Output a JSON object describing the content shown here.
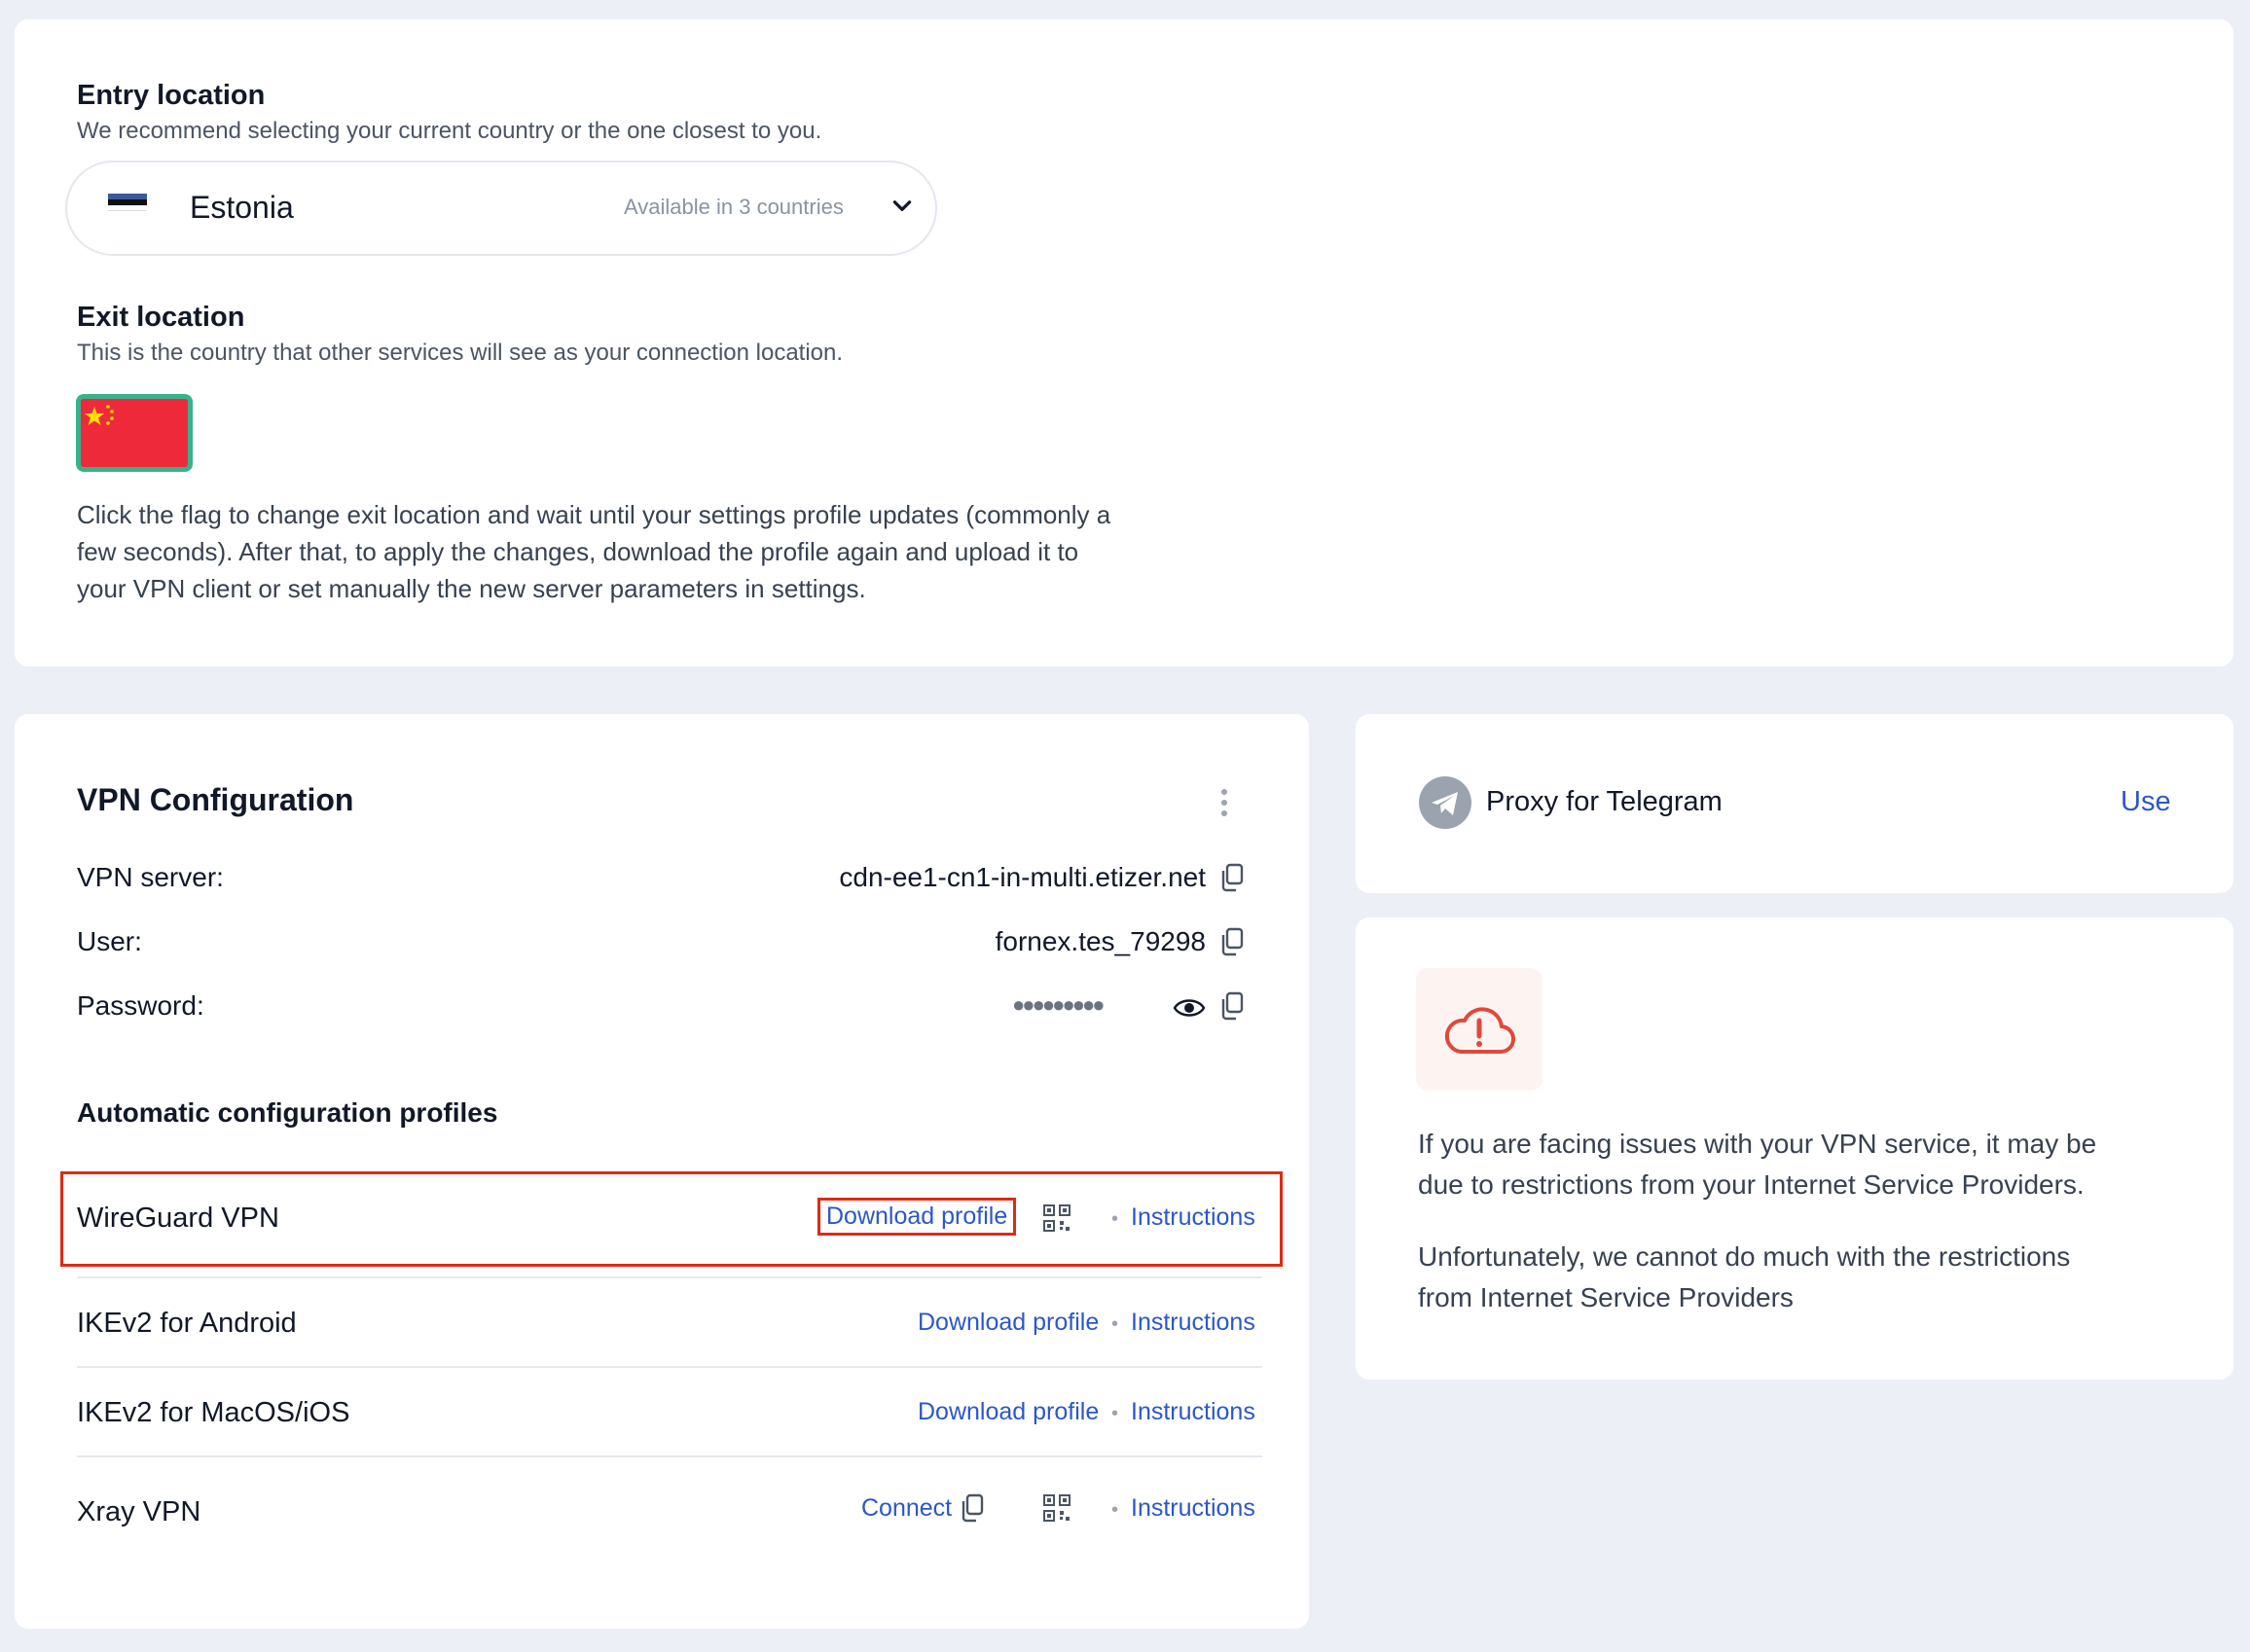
{
  "entry": {
    "title": "Entry location",
    "subtitle": "We recommend selecting your current country or the one closest to you.",
    "selected_country": "Estonia",
    "availability": "Available in 3 countries"
  },
  "exit": {
    "title": "Exit location",
    "subtitle": "This is the country that other services will see as your connection location.",
    "instructions_line1": "Click the flag to change exit location and wait until your settings profile updates (commonly a",
    "instructions_line2": "few seconds). After that, to apply the changes, download the profile again and upload it to",
    "instructions_line3": "your VPN client or set manually the new server parameters in settings."
  },
  "vpn": {
    "title": "VPN Configuration",
    "server_label": "VPN server:",
    "server_value": "cdn-ee1-cn1-in-multi.etizer.net",
    "user_label": "User:",
    "user_value": "fornex.tes_79298",
    "password_label": "Password:",
    "password_mask": "●●●●●●●●●",
    "profiles_title": "Automatic configuration profiles",
    "profiles": [
      {
        "name": "WireGuard VPN",
        "action": "Download profile",
        "instructions": "Instructions"
      },
      {
        "name": "IKEv2 for Android",
        "action": "Download profile",
        "instructions": "Instructions"
      },
      {
        "name": "IKEv2 for MacOS/iOS",
        "action": "Download profile",
        "instructions": "Instructions"
      },
      {
        "name": "Xray VPN",
        "action": "Connect",
        "instructions": "Instructions"
      }
    ],
    "separator": "•"
  },
  "telegram": {
    "label": "Proxy for Telegram",
    "action": "Use"
  },
  "warning": {
    "line1": "If you are facing issues with your VPN service, it may be",
    "line2": "due to restrictions from your Internet Service Providers.",
    "line3": "Unfortunately, we cannot do much with the restrictions",
    "line4": "from Internet Service Providers"
  },
  "colors": {
    "link": "#2b57c9",
    "highlight": "#e02a14",
    "flag_border": "#37b28c",
    "warning_icon": "#e0483c"
  }
}
